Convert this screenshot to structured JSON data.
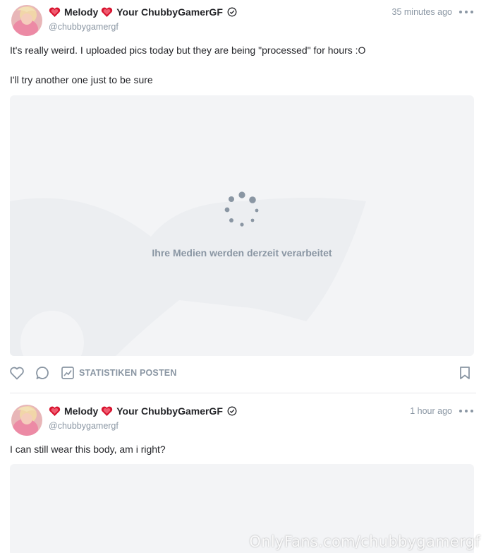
{
  "colors": {
    "text_primary": "#242529",
    "text_secondary": "#8a96a3",
    "media_placeholder": "#f3f4f6",
    "heart_red": "#d7132e"
  },
  "posts": [
    {
      "author": {
        "name_part1": "Melody",
        "name_part2": "Your ChubbyGamerGF",
        "handle": "@chubbygamergf",
        "verified_icon": "verified-check-icon",
        "emoji_icon": "sparkling-heart-icon"
      },
      "time": "35 minutes ago",
      "text_lines": [
        "It's really weird. I uploaded pics today but they are being \"processed\" for hours :O",
        "I'll try another one just to be sure"
      ],
      "media": {
        "status": "Ihre Medien werden derzeit verarbeitet",
        "spinner_icon": "loading-spinner-icon"
      },
      "actions": {
        "like_icon": "heart-outline-icon",
        "comment_icon": "comment-bubble-icon",
        "stats_icon": "stats-chart-icon",
        "stats_label": "STATISTIKEN POSTEN",
        "bookmark_icon": "bookmark-icon"
      }
    },
    {
      "author": {
        "name_part1": "Melody",
        "name_part2": "Your ChubbyGamerGF",
        "handle": "@chubbygamergf",
        "verified_icon": "verified-check-icon",
        "emoji_icon": "sparkling-heart-icon"
      },
      "time": "1 hour ago",
      "text_lines": [
        "I can still wear this body, am i right?"
      ]
    }
  ],
  "watermark": "OnlyFans.com/chubbygamergf"
}
